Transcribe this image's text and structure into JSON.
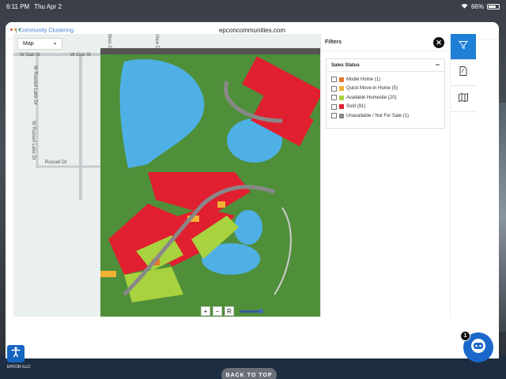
{
  "status_bar": {
    "time": "6:11 PM",
    "date": "Thu Apr 2",
    "battery": "66%"
  },
  "browser": {
    "url": "epconcommunities.com"
  },
  "breadcrumb": "Community Clustering",
  "map": {
    "type_select": "Map",
    "streets": [
      "W Oak St",
      "W Oak St",
      "W Russell Lake Dr",
      "W Russell Lake Dr",
      "Russell Dr",
      "Bren Dr",
      "View Dr"
    ],
    "controls": {
      "zoom_in": "+",
      "zoom_out": "−",
      "reset": "R"
    }
  },
  "filters": {
    "title": "Filters",
    "sales_status": {
      "title": "Sales Status",
      "items": [
        {
          "label": "Model Home (1)",
          "color": "#e8762b"
        },
        {
          "label": "Quick Move-in Home (5)",
          "color": "#f2b233"
        },
        {
          "label": "Available Homesite (20)",
          "color": "#a8d23e"
        },
        {
          "label": "Sold (91)",
          "color": "#e02030"
        },
        {
          "label": "Unavailable / Not For Sale (1)",
          "color": "#888888"
        }
      ]
    }
  },
  "sidebar": {
    "icons": [
      "filter-icon",
      "pdf-icon",
      "map-icon"
    ],
    "active": "filter-icon"
  },
  "footer": {
    "back_to_top": "BACK TO TOP",
    "brand": "EPCOR ILLC"
  },
  "chat": {
    "badge": "1"
  }
}
